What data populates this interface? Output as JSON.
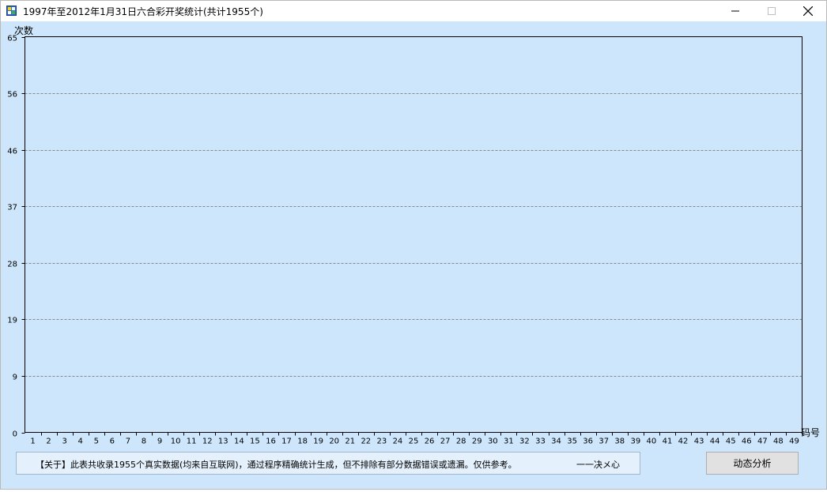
{
  "window": {
    "title": "1997年至2012年1月31日六合彩开奖统计(共计1955个)",
    "icon": "app-grid-icon"
  },
  "chart_data": {
    "type": "bar",
    "ylabel": "次数",
    "xlabel": "码号",
    "ylim": [
      0,
      65
    ],
    "yticks": [
      "0",
      "9",
      "19",
      "28",
      "37",
      "46",
      "56",
      "65"
    ],
    "ytick_values": [
      0,
      9.29,
      18.57,
      27.86,
      37.14,
      46.43,
      55.71,
      65
    ],
    "categories": [
      "1",
      "2",
      "3",
      "4",
      "5",
      "6",
      "7",
      "8",
      "9",
      "10",
      "11",
      "12",
      "13",
      "14",
      "15",
      "16",
      "17",
      "18",
      "19",
      "20",
      "21",
      "22",
      "23",
      "24",
      "25",
      "26",
      "27",
      "28",
      "29",
      "30",
      "31",
      "32",
      "33",
      "34",
      "35",
      "36",
      "37",
      "38",
      "39",
      "40",
      "41",
      "42",
      "43",
      "44",
      "45",
      "46",
      "47",
      "48",
      "49"
    ],
    "values": [],
    "grid": "horizontal-dashed",
    "colors": {
      "background": "#cde6fb",
      "grid": "#8a8a8a",
      "axis": "#000000"
    }
  },
  "footer": {
    "note": "【关于】此表共收录1955个真实数据(均来自互联网)，通过程序精确统计生成，但不排除有部分数据错误或遗漏。仅供参考。",
    "signature": "一一决メ心",
    "button_label": "动态分析"
  }
}
